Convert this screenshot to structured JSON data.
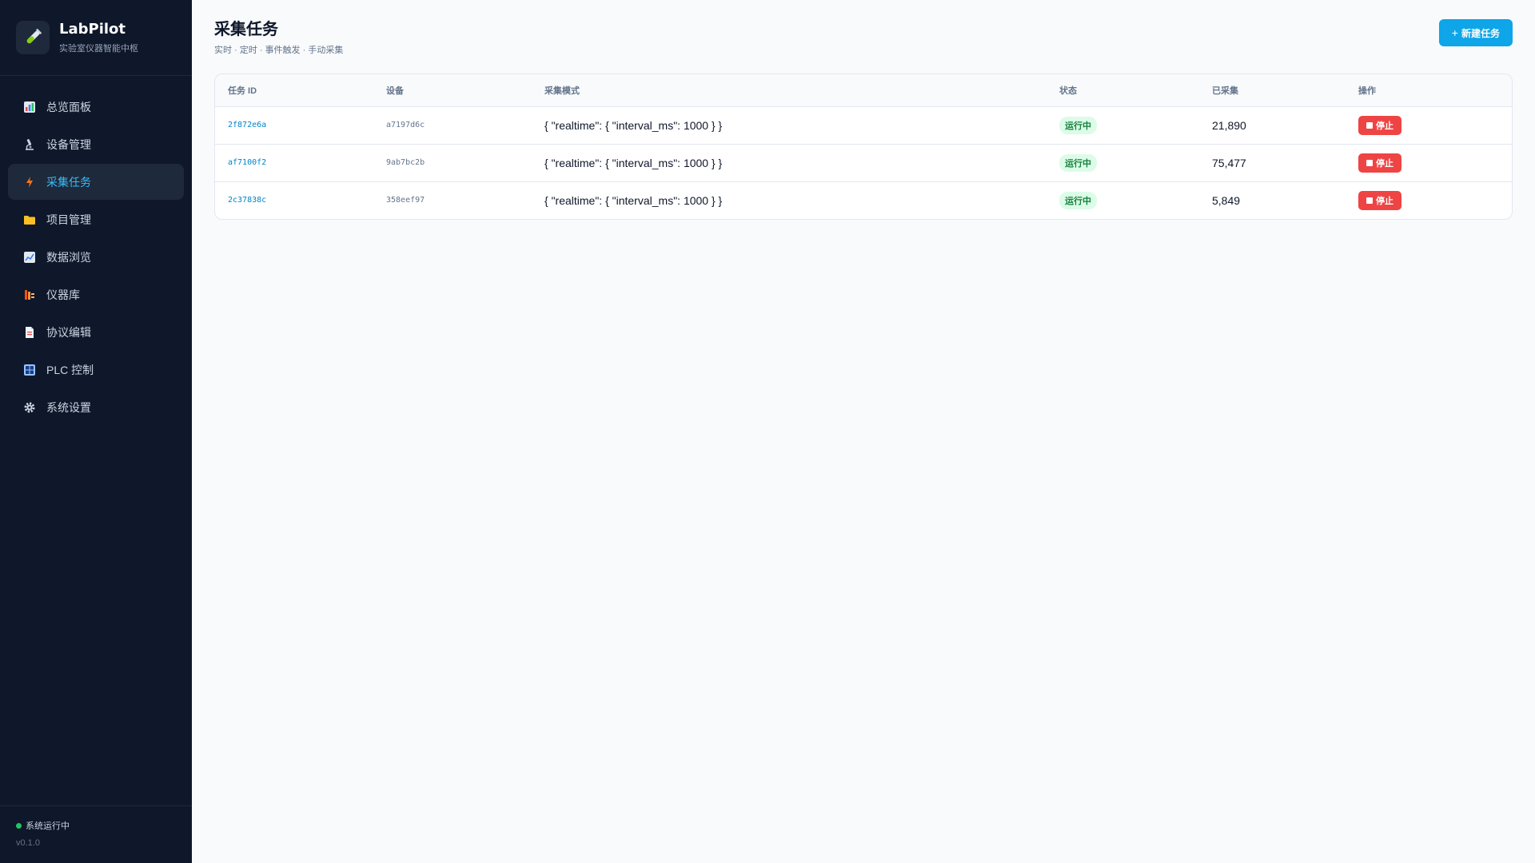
{
  "brand": {
    "name": "LabPilot",
    "subtitle": "实验室仪器智能中枢"
  },
  "sidebar": {
    "items": [
      {
        "label": "总览面板",
        "icon": "chart-icon",
        "active": false
      },
      {
        "label": "设备管理",
        "icon": "microscope-icon",
        "active": false
      },
      {
        "label": "采集任务",
        "icon": "lightning-icon",
        "active": true
      },
      {
        "label": "项目管理",
        "icon": "folder-icon",
        "active": false
      },
      {
        "label": "数据浏览",
        "icon": "trend-chart-icon",
        "active": false
      },
      {
        "label": "仪器库",
        "icon": "library-icon",
        "active": false
      },
      {
        "label": "协议编辑",
        "icon": "document-icon",
        "active": false
      },
      {
        "label": "PLC 控制",
        "icon": "grid-control-icon",
        "active": false
      },
      {
        "label": "系统设置",
        "icon": "gear-icon",
        "active": false
      }
    ],
    "status_text": "系统运行中",
    "version": "v0.1.0"
  },
  "header": {
    "title": "采集任务",
    "subtitle": "实时 · 定时 · 事件触发 · 手动采集",
    "new_button_label": "新建任务"
  },
  "table": {
    "columns": [
      "任务 ID",
      "设备",
      "采集模式",
      "状态",
      "已采集",
      "操作"
    ],
    "rows": [
      {
        "task_id": "2f872e6a",
        "device": "a7197d6c",
        "mode": "{ \"realtime\": { \"interval_ms\": 1000 } }",
        "status": "运行中",
        "collected": "21,890",
        "action": "停止"
      },
      {
        "task_id": "af7100f2",
        "device": "9ab7bc2b",
        "mode": "{ \"realtime\": { \"interval_ms\": 1000 } }",
        "status": "运行中",
        "collected": "75,477",
        "action": "停止"
      },
      {
        "task_id": "2c37838c",
        "device": "358eef97",
        "mode": "{ \"realtime\": { \"interval_ms\": 1000 } }",
        "status": "运行中",
        "collected": "5,849",
        "action": "停止"
      }
    ]
  },
  "colors": {
    "sidebar_bg": "#0f172a",
    "accent": "#0ea5e9",
    "active_text": "#38bdf8",
    "status_green": "#22c55e",
    "danger": "#ef4444"
  }
}
